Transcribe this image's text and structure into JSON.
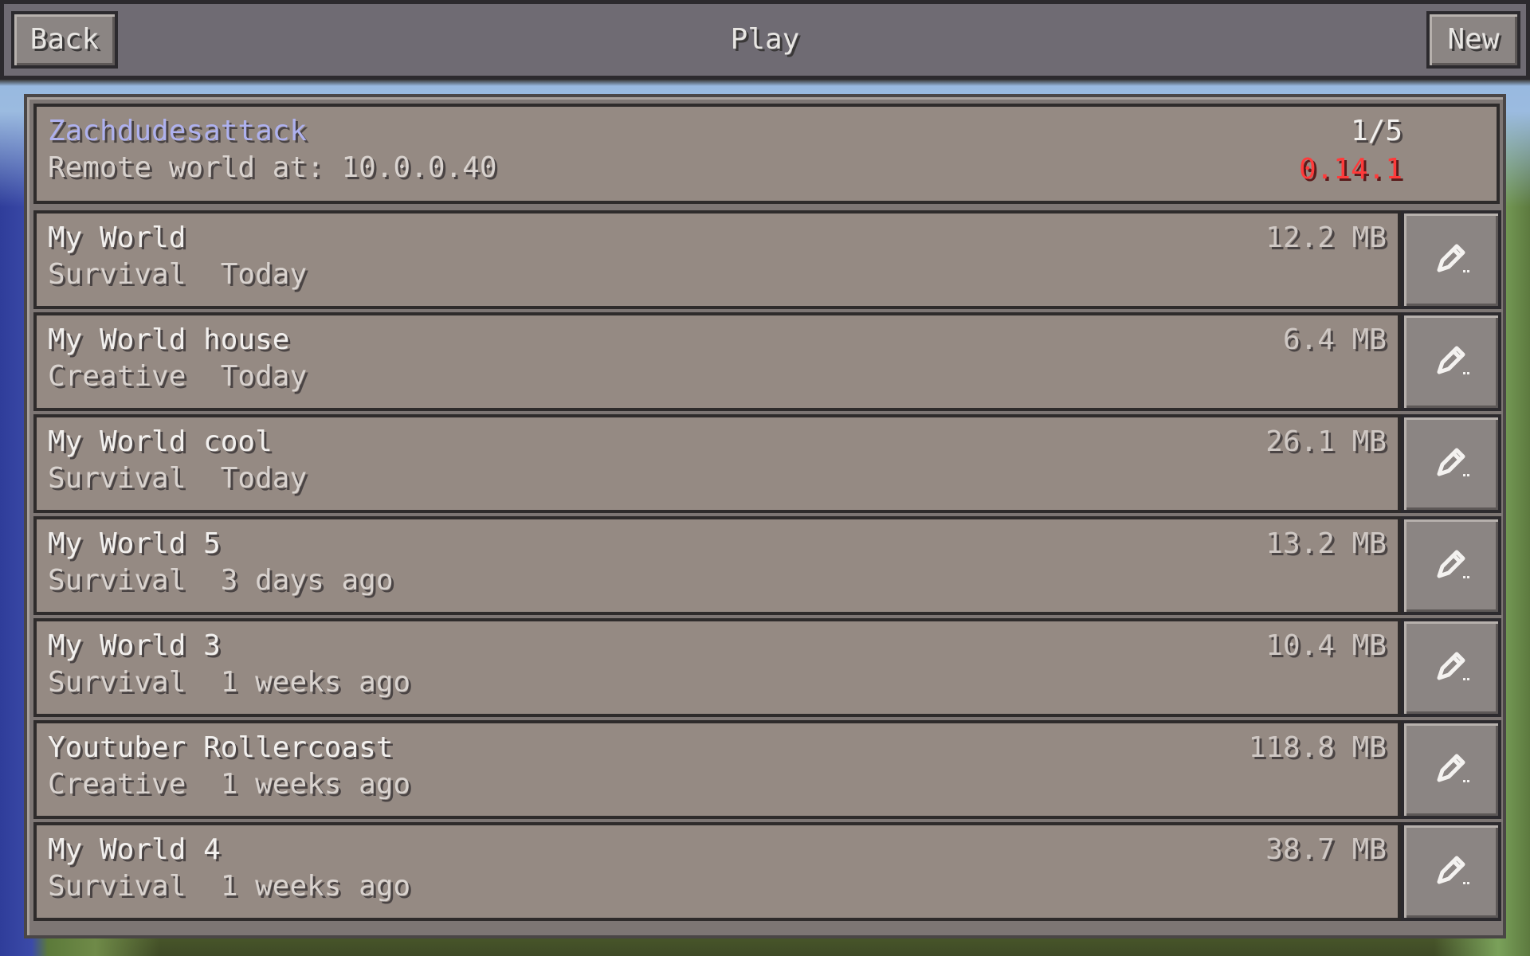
{
  "header": {
    "back_label": "Back",
    "title": "Play",
    "new_label": "New"
  },
  "server": {
    "name": "Zachdudesattack",
    "address": "Remote world at: 10.0.0.40",
    "players": "1/5",
    "version": "0.14.1"
  },
  "worlds": [
    {
      "name": "My World",
      "mode": "Survival",
      "date": "Today",
      "size": "12.2 MB"
    },
    {
      "name": "My World house",
      "mode": "Creative",
      "date": "Today",
      "size": "6.4 MB"
    },
    {
      "name": "My World cool",
      "mode": "Survival",
      "date": "Today",
      "size": "26.1 MB"
    },
    {
      "name": "My World 5",
      "mode": "Survival",
      "date": "3 days ago",
      "size": "13.2 MB"
    },
    {
      "name": "My World 3",
      "mode": "Survival",
      "date": "1 weeks ago",
      "size": "10.4 MB"
    },
    {
      "name": "Youtuber Rollercoast",
      "mode": "Creative",
      "date": "1 weeks ago",
      "size": "118.8 MB"
    },
    {
      "name": "My World 4",
      "mode": "Survival",
      "date": "1 weeks ago",
      "size": "38.7 MB"
    }
  ],
  "icons": {
    "edit": "pencil-icon"
  },
  "colors": {
    "server_name": "#aeb1ee",
    "version_mismatch": "#ff3a3a",
    "row_bg": "#958a83",
    "header_bg": "#6f6b73"
  }
}
